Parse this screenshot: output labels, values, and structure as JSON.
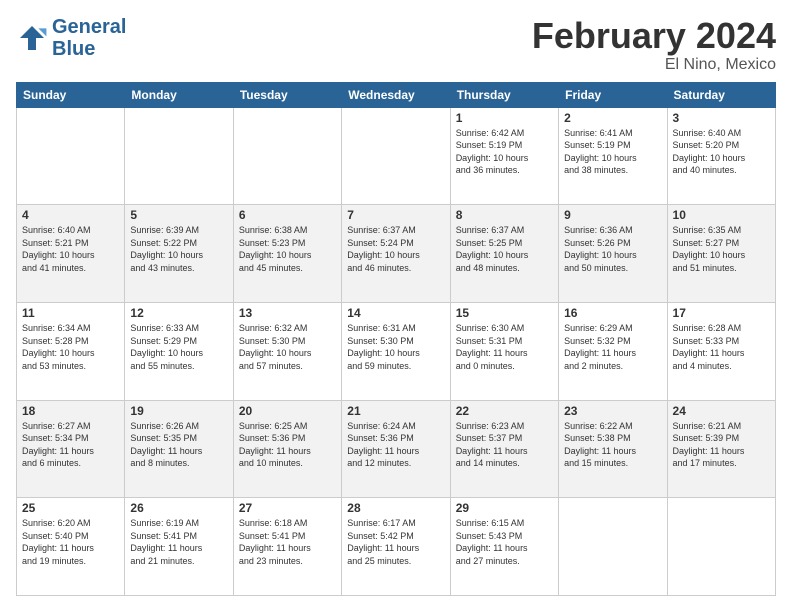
{
  "logo": {
    "line1": "General",
    "line2": "Blue"
  },
  "header": {
    "title": "February 2024",
    "subtitle": "El Nino, Mexico"
  },
  "weekdays": [
    "Sunday",
    "Monday",
    "Tuesday",
    "Wednesday",
    "Thursday",
    "Friday",
    "Saturday"
  ],
  "weeks": [
    [
      {
        "day": "",
        "content": ""
      },
      {
        "day": "",
        "content": ""
      },
      {
        "day": "",
        "content": ""
      },
      {
        "day": "",
        "content": ""
      },
      {
        "day": "1",
        "content": "Sunrise: 6:42 AM\nSunset: 5:19 PM\nDaylight: 10 hours\nand 36 minutes."
      },
      {
        "day": "2",
        "content": "Sunrise: 6:41 AM\nSunset: 5:19 PM\nDaylight: 10 hours\nand 38 minutes."
      },
      {
        "day": "3",
        "content": "Sunrise: 6:40 AM\nSunset: 5:20 PM\nDaylight: 10 hours\nand 40 minutes."
      }
    ],
    [
      {
        "day": "4",
        "content": "Sunrise: 6:40 AM\nSunset: 5:21 PM\nDaylight: 10 hours\nand 41 minutes."
      },
      {
        "day": "5",
        "content": "Sunrise: 6:39 AM\nSunset: 5:22 PM\nDaylight: 10 hours\nand 43 minutes."
      },
      {
        "day": "6",
        "content": "Sunrise: 6:38 AM\nSunset: 5:23 PM\nDaylight: 10 hours\nand 45 minutes."
      },
      {
        "day": "7",
        "content": "Sunrise: 6:37 AM\nSunset: 5:24 PM\nDaylight: 10 hours\nand 46 minutes."
      },
      {
        "day": "8",
        "content": "Sunrise: 6:37 AM\nSunset: 5:25 PM\nDaylight: 10 hours\nand 48 minutes."
      },
      {
        "day": "9",
        "content": "Sunrise: 6:36 AM\nSunset: 5:26 PM\nDaylight: 10 hours\nand 50 minutes."
      },
      {
        "day": "10",
        "content": "Sunrise: 6:35 AM\nSunset: 5:27 PM\nDaylight: 10 hours\nand 51 minutes."
      }
    ],
    [
      {
        "day": "11",
        "content": "Sunrise: 6:34 AM\nSunset: 5:28 PM\nDaylight: 10 hours\nand 53 minutes."
      },
      {
        "day": "12",
        "content": "Sunrise: 6:33 AM\nSunset: 5:29 PM\nDaylight: 10 hours\nand 55 minutes."
      },
      {
        "day": "13",
        "content": "Sunrise: 6:32 AM\nSunset: 5:30 PM\nDaylight: 10 hours\nand 57 minutes."
      },
      {
        "day": "14",
        "content": "Sunrise: 6:31 AM\nSunset: 5:30 PM\nDaylight: 10 hours\nand 59 minutes."
      },
      {
        "day": "15",
        "content": "Sunrise: 6:30 AM\nSunset: 5:31 PM\nDaylight: 11 hours\nand 0 minutes."
      },
      {
        "day": "16",
        "content": "Sunrise: 6:29 AM\nSunset: 5:32 PM\nDaylight: 11 hours\nand 2 minutes."
      },
      {
        "day": "17",
        "content": "Sunrise: 6:28 AM\nSunset: 5:33 PM\nDaylight: 11 hours\nand 4 minutes."
      }
    ],
    [
      {
        "day": "18",
        "content": "Sunrise: 6:27 AM\nSunset: 5:34 PM\nDaylight: 11 hours\nand 6 minutes."
      },
      {
        "day": "19",
        "content": "Sunrise: 6:26 AM\nSunset: 5:35 PM\nDaylight: 11 hours\nand 8 minutes."
      },
      {
        "day": "20",
        "content": "Sunrise: 6:25 AM\nSunset: 5:36 PM\nDaylight: 11 hours\nand 10 minutes."
      },
      {
        "day": "21",
        "content": "Sunrise: 6:24 AM\nSunset: 5:36 PM\nDaylight: 11 hours\nand 12 minutes."
      },
      {
        "day": "22",
        "content": "Sunrise: 6:23 AM\nSunset: 5:37 PM\nDaylight: 11 hours\nand 14 minutes."
      },
      {
        "day": "23",
        "content": "Sunrise: 6:22 AM\nSunset: 5:38 PM\nDaylight: 11 hours\nand 15 minutes."
      },
      {
        "day": "24",
        "content": "Sunrise: 6:21 AM\nSunset: 5:39 PM\nDaylight: 11 hours\nand 17 minutes."
      }
    ],
    [
      {
        "day": "25",
        "content": "Sunrise: 6:20 AM\nSunset: 5:40 PM\nDaylight: 11 hours\nand 19 minutes."
      },
      {
        "day": "26",
        "content": "Sunrise: 6:19 AM\nSunset: 5:41 PM\nDaylight: 11 hours\nand 21 minutes."
      },
      {
        "day": "27",
        "content": "Sunrise: 6:18 AM\nSunset: 5:41 PM\nDaylight: 11 hours\nand 23 minutes."
      },
      {
        "day": "28",
        "content": "Sunrise: 6:17 AM\nSunset: 5:42 PM\nDaylight: 11 hours\nand 25 minutes."
      },
      {
        "day": "29",
        "content": "Sunrise: 6:15 AM\nSunset: 5:43 PM\nDaylight: 11 hours\nand 27 minutes."
      },
      {
        "day": "",
        "content": ""
      },
      {
        "day": "",
        "content": ""
      }
    ]
  ]
}
